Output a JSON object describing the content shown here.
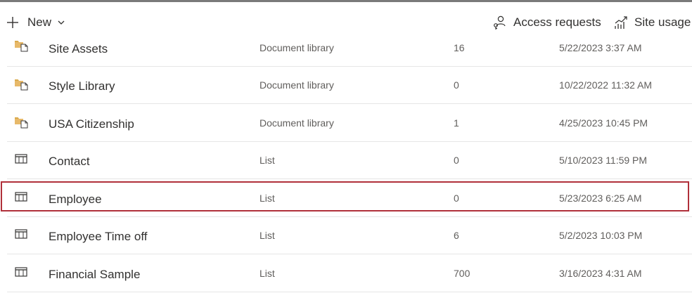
{
  "toolbar": {
    "new_label": "New",
    "access_requests_label": "Access requests",
    "site_usage_label": "Site usage"
  },
  "icons": {
    "new": "plus-icon",
    "new_dropdown": "chevron-down-icon",
    "access_requests": "people-key-icon",
    "site_usage": "chart-usage-icon",
    "document_library": "document-library-icon",
    "list": "list-icon"
  },
  "colors": {
    "library_icon": "#d9a94a",
    "highlight_border": "#b0303a",
    "top_border": "#7a7a7a"
  },
  "rows": [
    {
      "name": "Site Assets",
      "type": "Document library",
      "count": "16",
      "modified": "5/22/2023 3:37 AM",
      "kind": "library"
    },
    {
      "name": "Style Library",
      "type": "Document library",
      "count": "0",
      "modified": "10/22/2022 11:32 AM",
      "kind": "library"
    },
    {
      "name": "USA Citizenship",
      "type": "Document library",
      "count": "1",
      "modified": "4/25/2023 10:45 PM",
      "kind": "library"
    },
    {
      "name": "Contact",
      "type": "List",
      "count": "0",
      "modified": "5/10/2023 11:59 PM",
      "kind": "list"
    },
    {
      "name": "Employee",
      "type": "List",
      "count": "0",
      "modified": "5/23/2023 6:25 AM",
      "kind": "list",
      "highlighted": true
    },
    {
      "name": "Employee Time off",
      "type": "List",
      "count": "6",
      "modified": "5/2/2023 10:03 PM",
      "kind": "list"
    },
    {
      "name": "Financial Sample",
      "type": "List",
      "count": "700",
      "modified": "3/16/2023 4:31 AM",
      "kind": "list"
    }
  ]
}
